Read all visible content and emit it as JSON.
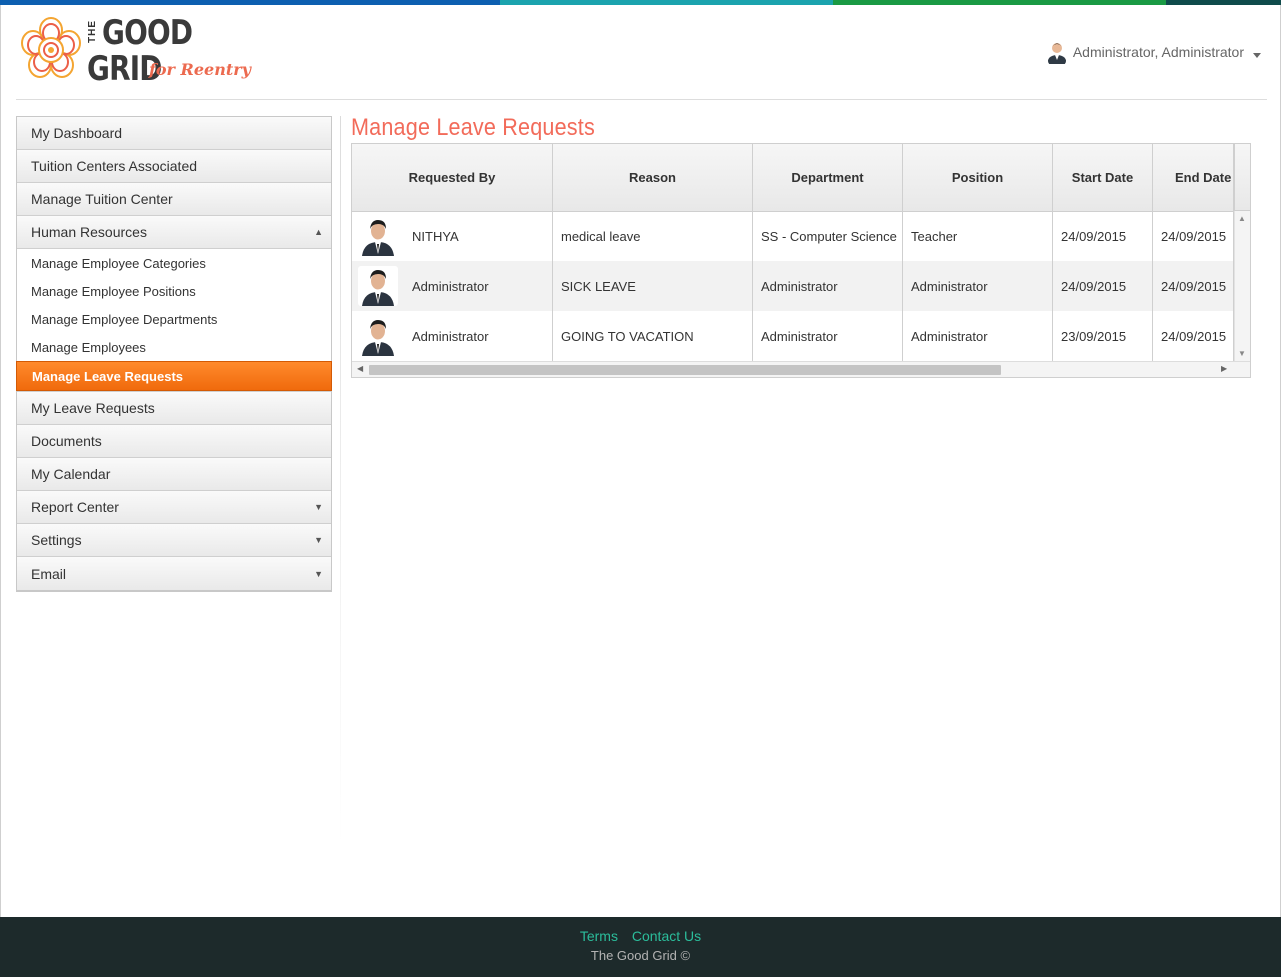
{
  "brand": {
    "colors": {
      "blue": "#0d5fb0",
      "teal": "#1ba3ae",
      "green": "#1a9a44",
      "dark": "#0f4b4b",
      "accent": "#f26b5a",
      "active": "#f47a1f",
      "footer_link": "#2bbd9b"
    },
    "logo_the": "THE",
    "logo_good": "GOOD",
    "logo_grid": "GRID",
    "logo_tagline": "for Reentry"
  },
  "header": {
    "user_name": "Administrator, Administrator",
    "user_icon": "user-avatar-icon"
  },
  "sidebar": {
    "items": [
      {
        "label": "My Dashboard"
      },
      {
        "label": "Tuition Centers Associated"
      },
      {
        "label": "Manage Tuition Center"
      },
      {
        "label": "Human Resources",
        "arrow": "▲"
      },
      {
        "label": "My Leave Requests"
      },
      {
        "label": "Documents"
      },
      {
        "label": "My Calendar"
      },
      {
        "label": "Report Center",
        "arrow": "▼"
      },
      {
        "label": "Settings",
        "arrow": "▼"
      },
      {
        "label": "Email",
        "arrow": "▼"
      }
    ],
    "sub_items": [
      {
        "label": "Manage Employee Categories"
      },
      {
        "label": "Manage Employee Positions"
      },
      {
        "label": "Manage Employee Departments"
      },
      {
        "label": "Manage Employees"
      },
      {
        "label": "Manage Leave Requests"
      }
    ]
  },
  "main": {
    "title": "Manage Leave Requests",
    "columns": [
      "Requested By",
      "Reason",
      "Department",
      "Position",
      "Start Date",
      "End Date"
    ],
    "rows": [
      {
        "requested_by": "NITHYA",
        "reason": "medical leave",
        "department": "SS - Computer Science",
        "position": "Teacher",
        "start": "24/09/2015",
        "end": "24/09/2015"
      },
      {
        "requested_by": "Administrator",
        "reason": "SICK LEAVE",
        "department": "Administrator",
        "position": "Administrator",
        "start": "24/09/2015",
        "end": "24/09/2015"
      },
      {
        "requested_by": "Administrator",
        "reason": "GOING TO VACATION",
        "department": "Administrator",
        "position": "Administrator",
        "start": "23/09/2015",
        "end": "24/09/2015"
      }
    ]
  },
  "footer": {
    "terms": "Terms",
    "contact": "Contact Us",
    "copyright": "The Good Grid ©"
  }
}
